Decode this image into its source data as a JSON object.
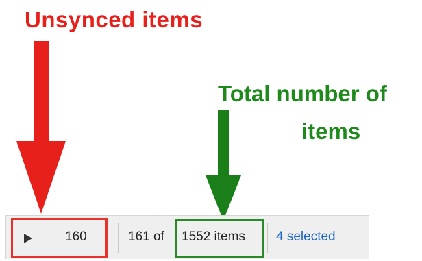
{
  "annotations": {
    "unsynced_label": "Unsynced  items",
    "total_label_line1": "Total number of",
    "total_label_line2": "items",
    "colors": {
      "red": "#e8201c",
      "green": "#1f8a1c"
    }
  },
  "statusbar": {
    "play_icon": "play-triangle-icon",
    "unsynced_count": "160",
    "position_text": "161 of",
    "total_items": "1552 items",
    "selected": "4 selected",
    "selected_color": "#1a66c6"
  }
}
